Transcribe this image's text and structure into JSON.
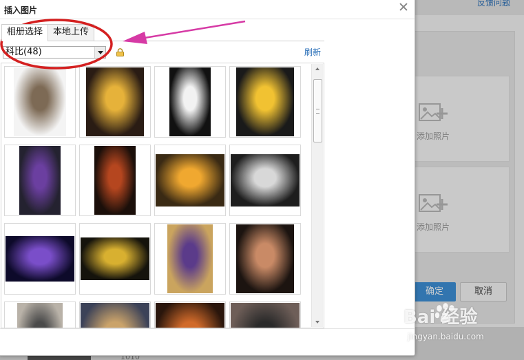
{
  "dialog": {
    "title": "插入图片",
    "close_icon": "close-icon"
  },
  "tabs": [
    {
      "label": "相册选择",
      "active": true
    },
    {
      "label": "本地上传",
      "active": false
    }
  ],
  "album_select": {
    "value": "科比(48)"
  },
  "refresh_label": "刷新",
  "gallery": {
    "photos": [
      {
        "desc": "dunk-photo"
      },
      {
        "desc": "dunk-photo"
      },
      {
        "desc": "white-jersey-poster"
      },
      {
        "desc": "portrait-photo"
      },
      {
        "desc": "portrait-photo"
      },
      {
        "desc": "dark-poster"
      },
      {
        "desc": "arena-photo"
      },
      {
        "desc": "grey-poster"
      },
      {
        "desc": "wings-poster"
      },
      {
        "desc": "logo-poster"
      },
      {
        "desc": "court-photo"
      },
      {
        "desc": "portrait-photo"
      },
      {
        "desc": "dunk-photo"
      },
      {
        "desc": "game-photo"
      },
      {
        "desc": "arena-photo"
      },
      {
        "desc": "court-photo"
      }
    ]
  },
  "background_page": {
    "feedback_link": "反馈问题",
    "add_photo_label": "添加照片",
    "confirm_label": "确定",
    "cancel_label": "取消",
    "date_fragment": "1010"
  },
  "watermark": {
    "logo": "Bai 经验",
    "sub": "jingyan.baidu.com"
  },
  "colors": {
    "link": "#2a6fb8",
    "confirm": "#3d8fd6",
    "annotation_red": "#d42020",
    "annotation_magenta": "#d63aa5"
  }
}
